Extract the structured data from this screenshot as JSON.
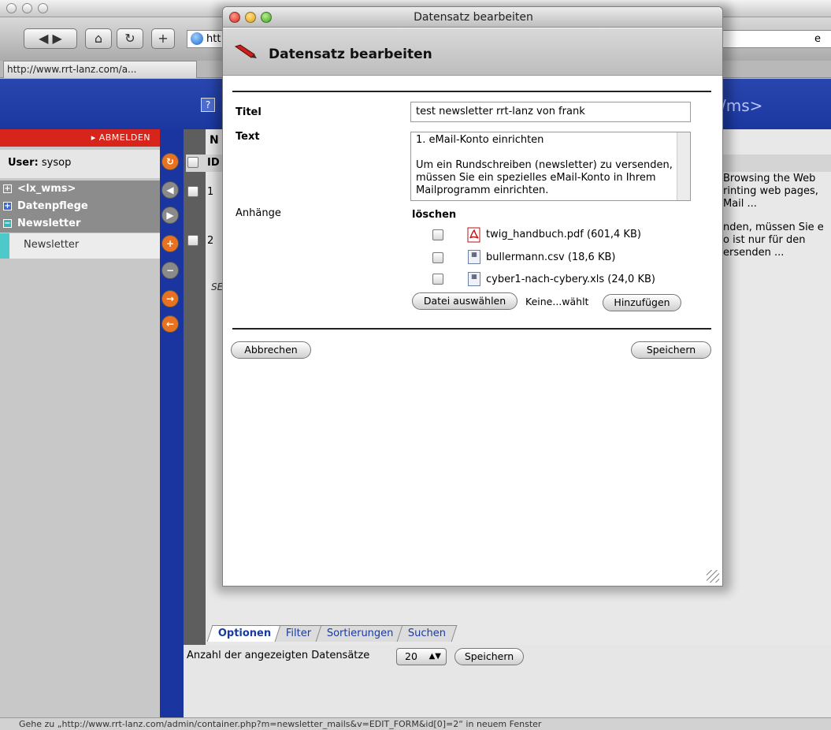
{
  "browser": {
    "url_partial": "htt",
    "url_right_partial": "e",
    "tab_label": "http://www.rrt-lanz.com/a...",
    "status_text": "Gehe zu „http://www.rrt-lanz.com/admin/container.php?m=newsletter_mails&v=EDIT_FORM&id[0]=2“ in neuem Fenster"
  },
  "cms": {
    "brand_partial": "/ms>",
    "help_label": "?",
    "logout": "▸ ABMELDEN",
    "user_label": "User:",
    "user_value": "sysop",
    "nav": [
      {
        "label": "<lx_wms>",
        "expander": "+"
      },
      {
        "label": "Datenpflege",
        "expander": "+"
      },
      {
        "label": "Newsletter",
        "expander": "−"
      }
    ],
    "subnav": "Newsletter",
    "table_title_partial": "N",
    "col_id_partial": "ID",
    "rows": [
      {
        "id": "1",
        "preview": [
          "Browsing the Web",
          "rinting web pages,",
          "Mail ..."
        ]
      },
      {
        "id": "2",
        "preview": [
          "nden, müssen Sie e",
          "o ist nur für den",
          "ersenden ..."
        ]
      }
    ],
    "seite_partial": "SE",
    "tabs": [
      "Optionen",
      "Filter",
      "Sortierungen",
      "Suchen"
    ],
    "records_label": "Anzahl der angezeigten Datensätze",
    "records_value": "20",
    "save_label": "Speichern"
  },
  "dialog": {
    "window_title": "Datensatz bearbeiten",
    "heading": "Datensatz bearbeiten",
    "title_label": "Titel",
    "title_value": "test newsletter rrt-lanz von frank",
    "text_label": "Text",
    "text_value": "1. eMail-Konto einrichten\n\nUm ein Rundschreiben (newsletter) zu versenden, müssen Sie ein spezielles eMail-Konto in Ihrem Mailprogramm einrichten.",
    "attachments_label": "Anhänge",
    "delete_label": "löschen",
    "files": [
      {
        "name": "twig_handbuch.pdf (601,4 KB)",
        "icon": "pdf-icon"
      },
      {
        "name": "bullermann.csv (18,6 KB)",
        "icon": "csv-icon"
      },
      {
        "name": "cyber1-nach-cybery.xls (24,0 KB)",
        "icon": "xls-icon"
      }
    ],
    "choose_file": "Datei auswählen",
    "no_file": "Keine...wählt",
    "add": "Hinzufügen",
    "cancel": "Abbrechen",
    "save": "Speichern"
  }
}
